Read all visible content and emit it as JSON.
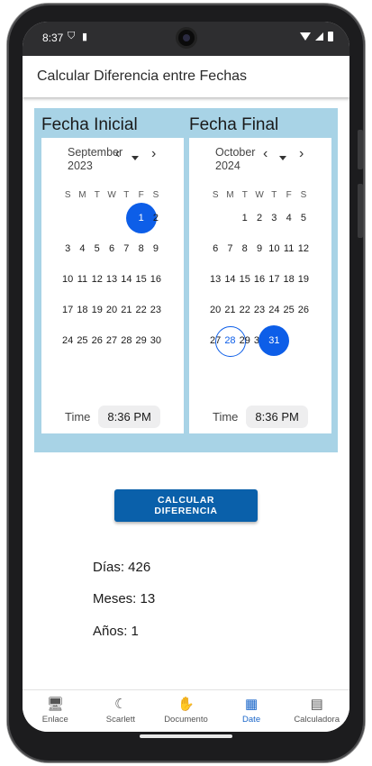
{
  "status_bar": {
    "time": "8:37",
    "icons": [
      "shield-icon",
      "sd-card-icon",
      "wifi-icon",
      "signal-icon",
      "battery-icon"
    ]
  },
  "app_bar": {
    "title": "Calcular Diferencia entre Fechas"
  },
  "weekday_headers": [
    "S",
    "M",
    "T",
    "W",
    "T",
    "F",
    "S"
  ],
  "start_calendar": {
    "heading": "Fecha Inicial",
    "month_line1": "September",
    "month_line2": "2023",
    "weeks": [
      [
        "",
        "",
        "",
        "",
        "",
        "1",
        "2"
      ],
      [
        "3",
        "4",
        "5",
        "6",
        "7",
        "8",
        "9"
      ],
      [
        "10",
        "11",
        "12",
        "13",
        "14",
        "15",
        "16"
      ],
      [
        "17",
        "18",
        "19",
        "20",
        "21",
        "22",
        "23"
      ],
      [
        "24",
        "25",
        "26",
        "27",
        "28",
        "29",
        "30"
      ]
    ],
    "selected_day": "1",
    "time_label": "Time",
    "time_value": "8:36 PM"
  },
  "end_calendar": {
    "heading": "Fecha Final",
    "month_line1": "October",
    "month_line2": "2024",
    "weeks": [
      [
        "",
        "",
        "1",
        "2",
        "3",
        "4",
        "5"
      ],
      [
        "6",
        "7",
        "8",
        "9",
        "10",
        "11",
        "12"
      ],
      [
        "13",
        "14",
        "15",
        "16",
        "17",
        "18",
        "19"
      ],
      [
        "20",
        "21",
        "22",
        "23",
        "24",
        "25",
        "26"
      ],
      [
        "27",
        "28",
        "29",
        "30",
        "31",
        "",
        ""
      ]
    ],
    "selected_day": "31",
    "today_day": "28",
    "time_label": "Time",
    "time_value": "8:36 PM"
  },
  "calculate_button": {
    "line1": "CALCULAR",
    "line2": "DIFERENCIA"
  },
  "results": {
    "days": "Días: 426",
    "months": "Meses: 13",
    "years": "Años: 1"
  },
  "bottom_nav": [
    {
      "label": "Enlace",
      "icon": "monitor-icon",
      "active": false
    },
    {
      "label": "Scarlett",
      "icon": "moon-icon",
      "active": false
    },
    {
      "label": "Documento",
      "icon": "hand-icon",
      "active": false
    },
    {
      "label": "Date",
      "icon": "calendar-icon",
      "active": true
    },
    {
      "label": "Calculadora",
      "icon": "calculator-icon",
      "active": false
    }
  ],
  "colors": {
    "accent": "#0d5ee8",
    "button": "#0a60aa",
    "panel": "#a8d3e6",
    "active_nav": "#1a66c9"
  }
}
